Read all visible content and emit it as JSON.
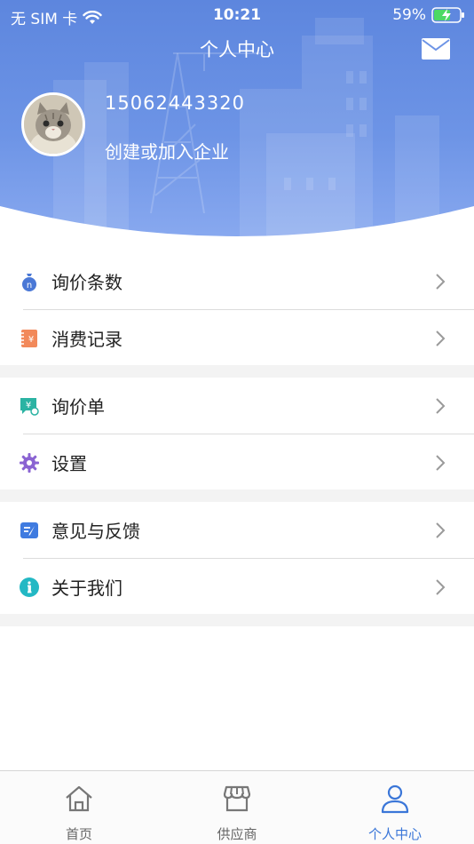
{
  "status_bar": {
    "carrier": "无 SIM 卡",
    "time": "10:21",
    "battery": "59%",
    "icons": [
      "wifi-icon",
      "battery-charging-icon"
    ]
  },
  "header": {
    "title": "个人中心",
    "mail_icon": "mail-icon",
    "phone": "15062443320",
    "join_company": "创建或加入企业",
    "gradient_colors": [
      "#5d86de",
      "#8aaaf0"
    ]
  },
  "menu": {
    "inquiry_count": "询价条数",
    "consumption_record": "消费记录",
    "inquiry_sheet": "询价单",
    "settings": "设置",
    "feedback": "意见与反馈",
    "about_us": "关于我们"
  },
  "tabs": [
    {
      "label": "首页",
      "icon": "home-icon",
      "active": false
    },
    {
      "label": "供应商",
      "icon": "store-icon",
      "active": false
    },
    {
      "label": "个人中心",
      "icon": "user-icon",
      "active": true
    }
  ],
  "colors": {
    "accent": "#3a76d8",
    "tab_inactive": "#666666",
    "separator_bg": "#f3f3f3"
  }
}
